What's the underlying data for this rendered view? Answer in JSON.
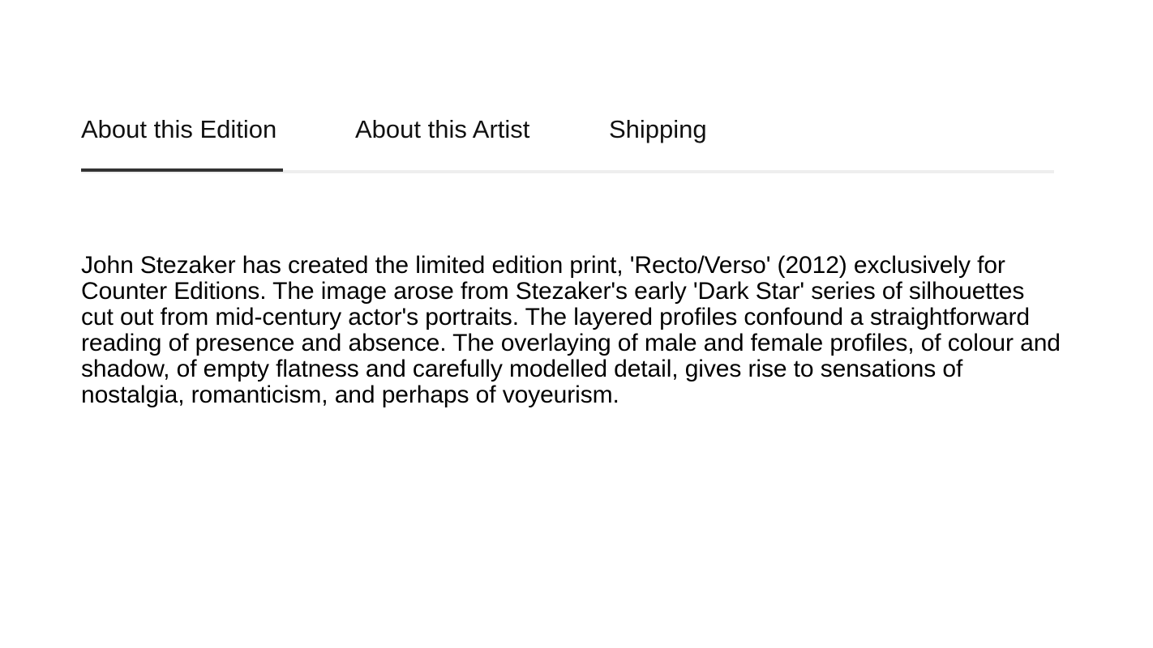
{
  "tabs": [
    {
      "label": "About this Edition",
      "active": true
    },
    {
      "label": "About this Artist",
      "active": false
    },
    {
      "label": "Shipping",
      "active": false
    }
  ],
  "content": {
    "description": "John Stezaker has created the limited edition print, 'Recto/Verso' (2012) exclusively for Counter Editions. The image arose from Stezaker's early 'Dark Star' series of silhouettes cut out from mid-century actor's portraits. The layered profiles confound a straightforward reading of presence and absence. The overlaying of male and female profiles, of colour and shadow, of empty flatness and carefully modelled detail, gives rise to sensations of nostalgia, romanticism, and perhaps of voyeurism."
  },
  "colors": {
    "active_underline": "#333333",
    "tab_track": "#eeeeee",
    "text": "#000000"
  }
}
